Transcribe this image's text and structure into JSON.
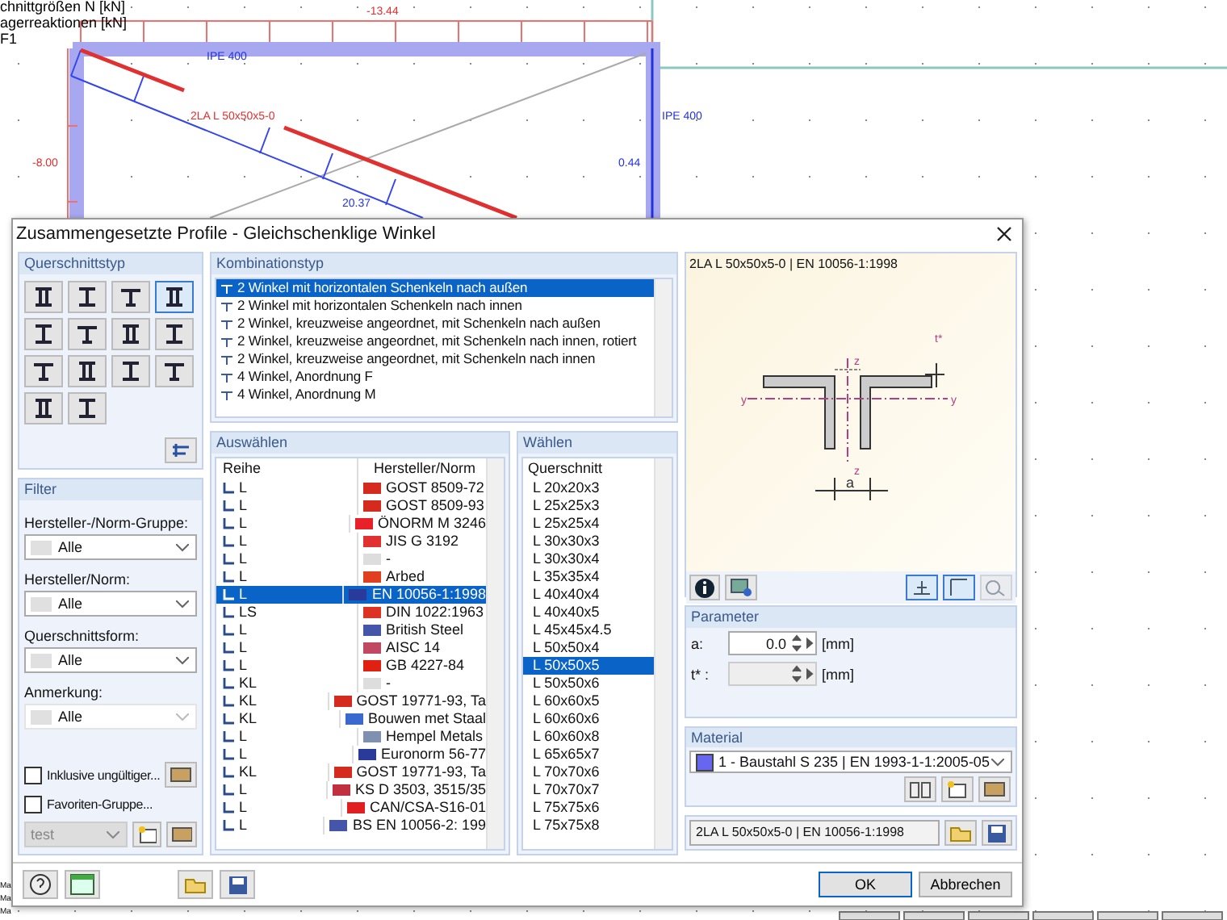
{
  "background": {
    "legend": [
      "chnittgrößen N [kN]",
      "agerreaktionen [kN]",
      "F1"
    ],
    "labels": [
      {
        "kind": "force",
        "text": "-13.44"
      },
      {
        "kind": "section",
        "text": "IPE 400"
      },
      {
        "kind": "force",
        "text": "2LA L 50x50x5-0"
      },
      {
        "kind": "section",
        "text": "IPE 400"
      },
      {
        "kind": "force",
        "text": "-8.00"
      },
      {
        "kind": "section",
        "text": "0.44"
      },
      {
        "kind": "section",
        "text": "20.37"
      }
    ],
    "side_fragments": [
      "Ma",
      "Ma",
      "Ma"
    ]
  },
  "window": {
    "title": "Zusammengesetzte Profile - Gleichschenklige Winkel"
  },
  "section_type": {
    "title": "Querschnittstyp",
    "buttons": [
      {
        "selected": false
      },
      {
        "selected": false
      },
      {
        "selected": false
      },
      {
        "selected": true
      },
      {
        "selected": false
      },
      {
        "selected": false
      },
      {
        "selected": false
      },
      {
        "selected": false
      },
      {
        "selected": false
      },
      {
        "selected": false
      },
      {
        "selected": false
      },
      {
        "selected": false
      },
      {
        "selected": false
      },
      {
        "selected": false
      }
    ]
  },
  "filter": {
    "title": "Filter",
    "fields": [
      {
        "label": "Hersteller-/Norm-Gruppe:",
        "value": "Alle",
        "disabled": false
      },
      {
        "label": "Hersteller/Norm:",
        "value": "Alle",
        "disabled": false
      },
      {
        "label": "Querschnittsform:",
        "value": "Alle",
        "disabled": false
      },
      {
        "label": "Anmerkung:",
        "value": "Alle",
        "disabled": true
      }
    ],
    "checkboxes": [
      {
        "label": "Inklusive ungültiger...",
        "checked": false
      },
      {
        "label": "Favoriten-Gruppe...",
        "checked": false
      }
    ],
    "favorite_group": {
      "value": "test",
      "disabled": true
    }
  },
  "combination": {
    "title": "Kombinationstyp",
    "items": [
      {
        "label": "2 Winkel mit horizontalen Schenkeln nach außen",
        "selected": true
      },
      {
        "label": "2 Winkel mit horizontalen Schenkeln nach innen",
        "selected": false
      },
      {
        "label": "2 Winkel, kreuzweise angeordnet, mit Schenkeln nach außen",
        "selected": false
      },
      {
        "label": "2 Winkel, kreuzweise angeordnet, mit Schenkeln nach innen, rotiert",
        "selected": false
      },
      {
        "label": "2 Winkel, kreuzweise angeordnet, mit Schenkeln nach innen",
        "selected": false
      },
      {
        "label": "4 Winkel, Anordnung F",
        "selected": false
      },
      {
        "label": "4 Winkel, Anordnung M",
        "selected": false
      }
    ]
  },
  "select": {
    "title": "Auswählen",
    "columns": [
      "Reihe",
      "Hersteller/Norm"
    ],
    "rows": [
      {
        "series": "L",
        "norm": "GOST 8509-72",
        "color": "#d52b1e",
        "selected": false
      },
      {
        "series": "L",
        "norm": "GOST 8509-93",
        "color": "#d52b1e",
        "selected": false
      },
      {
        "series": "L",
        "norm": "ÖNORM M 3246",
        "color": "#e8202a",
        "selected": false
      },
      {
        "series": "L",
        "norm": "JIS G 3192",
        "color": "#e03030",
        "selected": false
      },
      {
        "series": "L",
        "norm": "-",
        "color": "#dddddd",
        "selected": false
      },
      {
        "series": "L",
        "norm": "Arbed",
        "color": "#e04020",
        "selected": false
      },
      {
        "series": "L",
        "norm": "EN 10056-1:1998",
        "color": "#2a3a9a",
        "selected": true
      },
      {
        "series": "LS",
        "norm": "DIN 1022:1963",
        "color": "#dd3322",
        "selected": false
      },
      {
        "series": "L",
        "norm": "British Steel",
        "color": "#4455aa",
        "selected": false
      },
      {
        "series": "L",
        "norm": "AISC 14",
        "color": "#c04860",
        "selected": false
      },
      {
        "series": "L",
        "norm": "GB 4227-84",
        "color": "#e02010",
        "selected": false
      },
      {
        "series": "KL",
        "norm": "-",
        "color": "#dddddd",
        "selected": false
      },
      {
        "series": "KL",
        "norm": "GOST 19771-93, Ta",
        "color": "#d52b1e",
        "selected": false
      },
      {
        "series": "KL",
        "norm": "Bouwen met Staal",
        "color": "#3a6ad0",
        "selected": false
      },
      {
        "series": "L",
        "norm": "Hempel Metals",
        "color": "#8090b0",
        "selected": false
      },
      {
        "series": "L",
        "norm": "Euronorm 56-77",
        "color": "#2a3a9a",
        "selected": false
      },
      {
        "series": "KL",
        "norm": "GOST 19771-93, Ta",
        "color": "#d52b1e",
        "selected": false
      },
      {
        "series": "L",
        "norm": "KS D 3503, 3515/35",
        "color": "#c03040",
        "selected": false
      },
      {
        "series": "L",
        "norm": "CAN/CSA-S16-01",
        "color": "#e02020",
        "selected": false
      },
      {
        "series": "L",
        "norm": "BS EN 10056-2: 199",
        "color": "#4455aa",
        "selected": false
      }
    ]
  },
  "choose": {
    "title": "Wählen",
    "column": "Querschnitt",
    "items": [
      {
        "label": "L 20x20x3",
        "selected": false
      },
      {
        "label": "L 25x25x3",
        "selected": false
      },
      {
        "label": "L 25x25x4",
        "selected": false
      },
      {
        "label": "L 30x30x3",
        "selected": false
      },
      {
        "label": "L 30x30x4",
        "selected": false
      },
      {
        "label": "L 35x35x4",
        "selected": false
      },
      {
        "label": "L 40x40x4",
        "selected": false
      },
      {
        "label": "L 40x40x5",
        "selected": false
      },
      {
        "label": "L 45x45x4.5",
        "selected": false
      },
      {
        "label": "L 50x50x4",
        "selected": false
      },
      {
        "label": "L 50x50x5",
        "selected": true
      },
      {
        "label": "L 50x50x6",
        "selected": false
      },
      {
        "label": "L 60x60x5",
        "selected": false
      },
      {
        "label": "L 60x60x6",
        "selected": false
      },
      {
        "label": "L 60x60x8",
        "selected": false
      },
      {
        "label": "L 65x65x7",
        "selected": false
      },
      {
        "label": "L 70x70x6",
        "selected": false
      },
      {
        "label": "L 70x70x7",
        "selected": false
      },
      {
        "label": "L 75x75x6",
        "selected": false
      },
      {
        "label": "L 75x75x8",
        "selected": false
      }
    ]
  },
  "preview": {
    "title": "2LA L 50x50x5-0 | EN 10056-1:1998",
    "drawing_labels": [
      "z",
      "y",
      "y",
      "z",
      "a",
      "t*"
    ],
    "tools": [
      {
        "on": true
      },
      {
        "on": true
      },
      {
        "on": false
      }
    ]
  },
  "parameter": {
    "title": "Parameter",
    "rows": [
      {
        "label": "a:",
        "value": "0.0",
        "unit": "[mm]",
        "disabled": false
      },
      {
        "label": "t* :",
        "unit": "[mm]",
        "disabled": true
      }
    ]
  },
  "material": {
    "title": "Material",
    "value": "1 - Baustahl S 235 | EN 1993-1-1:2005-05",
    "color": "#6666ee"
  },
  "name_field": {
    "value": "2LA L 50x50x5-0 | EN 10056-1:1998"
  },
  "buttons": [
    {
      "label": "OK",
      "default": true
    },
    {
      "label": "Abbrechen",
      "default": false
    }
  ]
}
